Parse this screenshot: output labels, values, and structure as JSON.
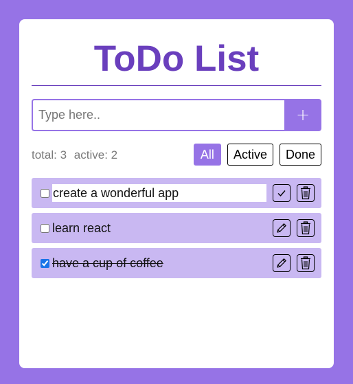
{
  "title": "ToDo List",
  "add": {
    "placeholder": "Type here..",
    "button_label": "+"
  },
  "stats": {
    "total": "total: 3",
    "active": "active: 2"
  },
  "filters": [
    {
      "label": "All",
      "selected": true
    },
    {
      "label": "Active",
      "selected": false
    },
    {
      "label": "Done",
      "selected": false
    }
  ],
  "todos": [
    {
      "text": "create a wonderful app",
      "done": false,
      "editing": true
    },
    {
      "text": "learn react",
      "done": false,
      "editing": false
    },
    {
      "text": "have a cup of coffee",
      "done": true,
      "editing": false
    }
  ],
  "colors": {
    "background": "#9673e6",
    "accent": "#6a3fbd",
    "item_bg": "#c9b8f2"
  }
}
